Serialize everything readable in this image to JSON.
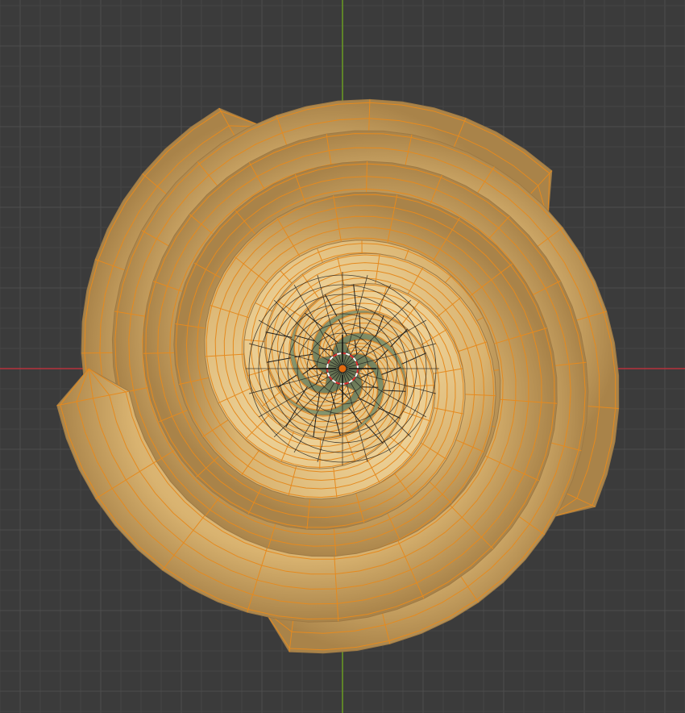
{
  "viewport": {
    "background_color": "#3b3b3b",
    "grid_minor_color": "#444444",
    "grid_major_color": "#4e4e4e",
    "axis_x_color": "#b8323d",
    "axis_y_color": "#6a9b22"
  },
  "mesh": {
    "surface_color": "#d8b572",
    "surface_highlight_color": "#f0d49a",
    "surface_shadow_color": "#9e7a45",
    "base_green_color": "#a7b88a",
    "wire_selected_color": "#e58a1f",
    "wire_unselected_color": "#1c1c1c",
    "arm_count": 5
  },
  "origin": {
    "cursor_icon": "3d-cursor-icon",
    "origin_icon": "object-origin-icon",
    "cursor_ring_color": "#e03030",
    "origin_dot_color": "#e06a10"
  }
}
